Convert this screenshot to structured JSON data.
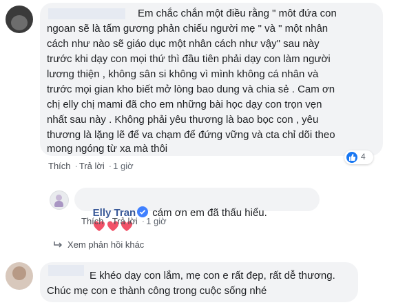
{
  "comment1": {
    "lines": [
      "Em chắc chắn một điều rằng \" môt đứa con",
      "ngoan sẽ là tấm gương phản chiếu người mẹ \" và \" một nhân",
      "cách như nào sẽ giáo dục một nhân cách như vậy\" sau này",
      "trước khi dạy con mọi thứ thì đầu tiên phải dạy con làm người",
      "lương thiện , không sân si không vì mình không cá nhân và",
      "trước mọi gian kho biết mở lòng bao dung và chia sẻ . Cam ơn",
      "chị elly chị mami đã cho em những bài học dạy con trọn vẹn",
      "nhất sau này . Không phải yêu thương là bao bọc con , yêu",
      "thương là lặng lẽ để va chạm để đứng vững và cta chỉ dõi theo",
      "mong ngóng từ xa mà thôi"
    ],
    "like_label": "Thích",
    "reply_label": "Trả lời",
    "time": "1 giờ",
    "reaction_count": "4"
  },
  "reply": {
    "author": "Elly Tran",
    "text": "cám ơn em đã thấu hiểu.",
    "like_label": "Thích",
    "reply_label": "Trả lời",
    "time": "1 giờ"
  },
  "more_replies_label": "Xem phản hồi khác",
  "comment2": {
    "lines": [
      "E khéo dạy con lắm, mẹ con e rất đẹp, rất dễ thương.",
      "Chúc mẹ con e thành công trong cuộc sống nhé"
    ]
  },
  "colors": {
    "name": "#385898",
    "heart": "#f25268",
    "like": "#1877f2",
    "bubble": "#f2f3f5"
  }
}
